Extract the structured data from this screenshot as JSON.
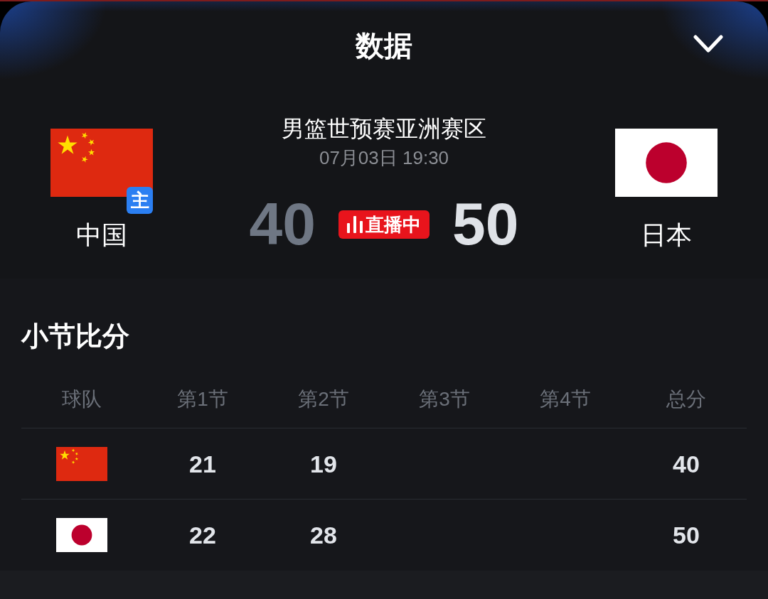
{
  "header": {
    "title": "数据"
  },
  "match": {
    "competition": "男篮世预赛亚洲赛区",
    "datetime": "07月03日 19:30",
    "status": "直播中"
  },
  "teams": [
    {
      "kind": "china",
      "name": "中国",
      "badge": "主",
      "score": "40",
      "leading": false
    },
    {
      "kind": "japan",
      "name": "日本",
      "score": "50",
      "leading": true
    }
  ],
  "quarter_scores": {
    "title": "小节比分",
    "columns": [
      "球队",
      "第1节",
      "第2节",
      "第3节",
      "第4节",
      "总分"
    ],
    "rows": [
      {
        "kind": "china",
        "periods": [
          "21",
          "19"
        ],
        "total": "40"
      },
      {
        "kind": "japan",
        "periods": [
          "22",
          "28"
        ],
        "total": "50"
      }
    ]
  }
}
